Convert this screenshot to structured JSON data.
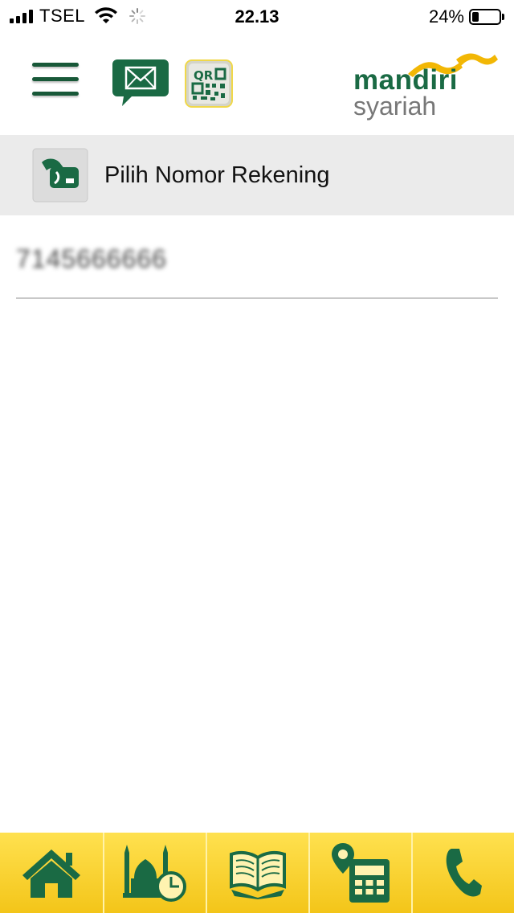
{
  "status_bar": {
    "carrier": "TSEL",
    "time": "22.13",
    "battery": "24%",
    "battery_level": 0.24
  },
  "header": {
    "logo": {
      "line1": "mandiri",
      "line2": "syariah"
    },
    "qr_label": "QR"
  },
  "section": {
    "title": "Pilih Nomor Rekening"
  },
  "accounts": [
    {
      "number": "7145666666"
    }
  ],
  "bottom_nav": {
    "items": [
      "home-icon",
      "prayer-time-icon",
      "quran-icon",
      "branch-locator-icon",
      "phone-icon"
    ]
  },
  "colors": {
    "brand_green": "#1a6a44",
    "brand_yellow": "#f3c519",
    "section_bg": "#ebebeb"
  }
}
